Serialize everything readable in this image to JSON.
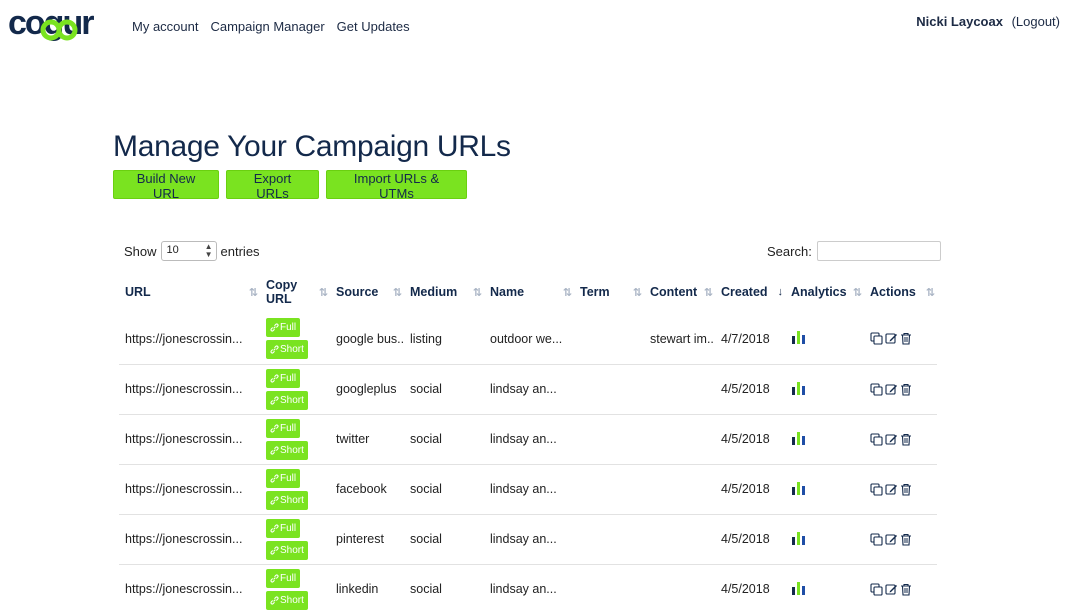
{
  "brand": {
    "logo_text": "cogur",
    "accent": "#7ae320",
    "navy": "#13294b"
  },
  "nav": {
    "items": [
      "My account",
      "Campaign Manager",
      "Get Updates"
    ]
  },
  "user": {
    "name": "Nicki Laycoax",
    "logout_label": "(Logout)"
  },
  "page": {
    "title": "Manage Your Campaign URLs"
  },
  "toolbar": {
    "build_label": "Build New URL",
    "export_label": "Export URLs",
    "import_label": "Import URLs & UTMs"
  },
  "table_controls": {
    "show_label": "Show",
    "entries_value": "10",
    "entries_label": "entries",
    "search_label": "Search:"
  },
  "table": {
    "headers": [
      "URL",
      "Copy URL",
      "Source",
      "Medium",
      "Name",
      "Term",
      "Content",
      "Created",
      "Analytics",
      "Actions"
    ],
    "copy_full_label": "Full",
    "copy_short_label": "Short",
    "rows": [
      {
        "url": "https://jonescrossin...",
        "source": "google bus...",
        "medium": "listing",
        "name": "outdoor we...",
        "term": "",
        "content": "stewart im...",
        "created": "4/7/2018"
      },
      {
        "url": "https://jonescrossin...",
        "source": "googleplus",
        "medium": "social",
        "name": "lindsay an...",
        "term": "",
        "content": "",
        "created": "4/5/2018"
      },
      {
        "url": "https://jonescrossin...",
        "source": "twitter",
        "medium": "social",
        "name": "lindsay an...",
        "term": "",
        "content": "",
        "created": "4/5/2018"
      },
      {
        "url": "https://jonescrossin...",
        "source": "facebook",
        "medium": "social",
        "name": "lindsay an...",
        "term": "",
        "content": "",
        "created": "4/5/2018"
      },
      {
        "url": "https://jonescrossin...",
        "source": "pinterest",
        "medium": "social",
        "name": "lindsay an...",
        "term": "",
        "content": "",
        "created": "4/5/2018"
      },
      {
        "url": "https://jonescrossin...",
        "source": "linkedin",
        "medium": "social",
        "name": "lindsay an...",
        "term": "",
        "content": "",
        "created": "4/5/2018"
      }
    ]
  }
}
